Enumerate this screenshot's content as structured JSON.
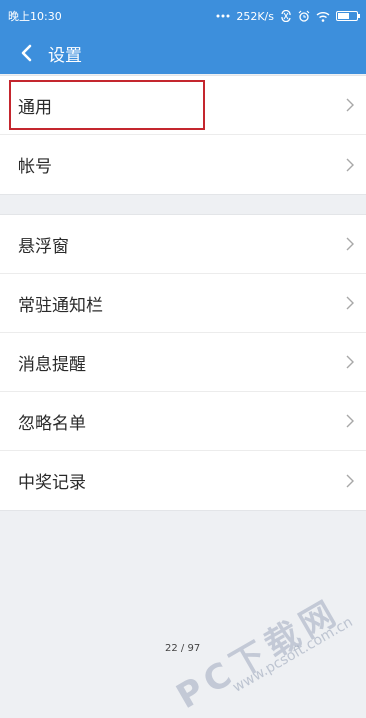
{
  "status_bar": {
    "time": "晚上10:30",
    "speed": "252K/s",
    "icons": [
      "signal-dots-icon",
      "bluetooth-sync-icon",
      "alarm-icon",
      "wifi-icon",
      "battery-icon"
    ],
    "battery_level": 0.55
  },
  "app_bar": {
    "title": "设置",
    "back_icon": "chevron-left-icon",
    "color": "#3d8fdc"
  },
  "groups": [
    {
      "items": [
        {
          "label": "通用"
        },
        {
          "label": "帐号"
        }
      ]
    },
    {
      "items": [
        {
          "label": "悬浮窗"
        },
        {
          "label": "常驻通知栏"
        },
        {
          "label": "消息提醒"
        },
        {
          "label": "忽略名单"
        },
        {
          "label": "中奖记录"
        }
      ]
    }
  ],
  "highlight_color": "#c4262e",
  "watermark": {
    "text": "PC下载网",
    "sub": "www.pcsoft.com.cn"
  },
  "page_indicator": "22 / 97"
}
